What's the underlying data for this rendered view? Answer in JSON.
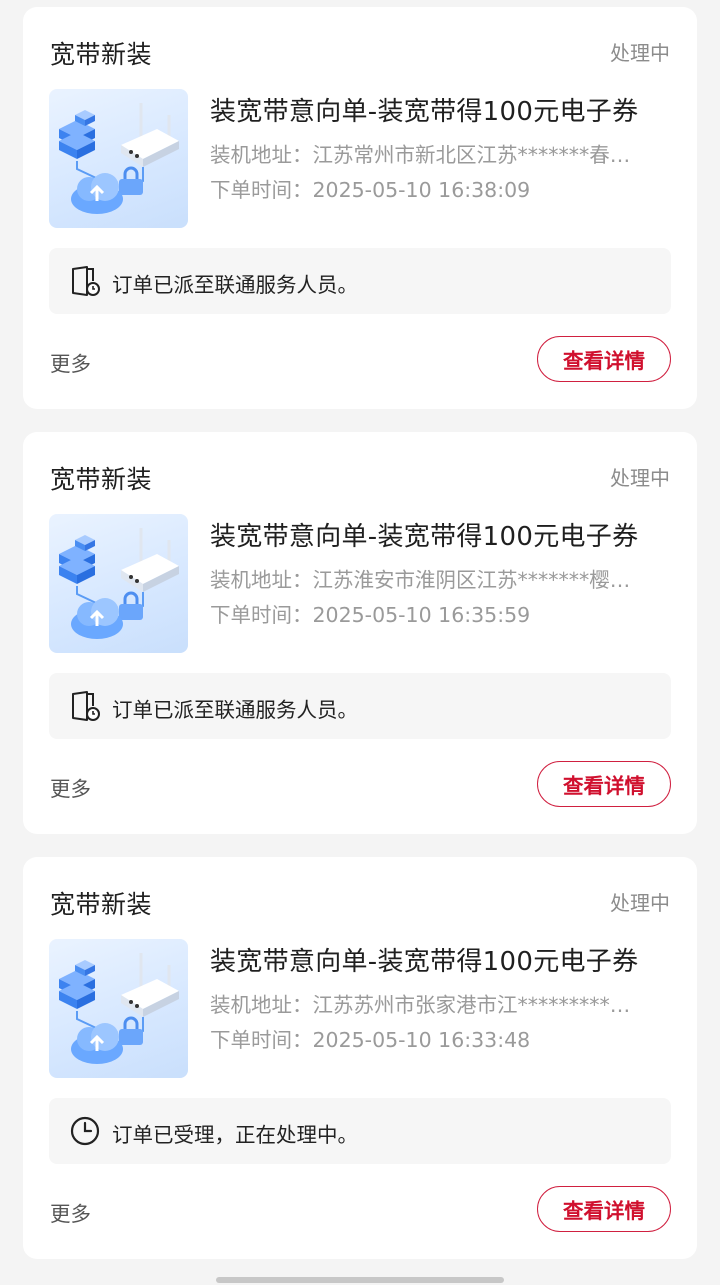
{
  "orders": [
    {
      "category": "宽带新装",
      "status": "处理中",
      "product_name": "装宽带意向单-装宽带得100元电子券",
      "address_line": "装机地址：江苏常州市新北区江苏*******春…",
      "time_line": "下单时间：2025-05-10 16:38:09",
      "notice_icon": "dispatch-door-icon",
      "notice": "订单已派至联通服务人员。",
      "more_label": "更多",
      "detail_label": "查看详情"
    },
    {
      "category": "宽带新装",
      "status": "处理中",
      "product_name": "装宽带意向单-装宽带得100元电子券",
      "address_line": "装机地址：江苏淮安市淮阴区江苏*******樱…",
      "time_line": "下单时间：2025-05-10 16:35:59",
      "notice_icon": "dispatch-door-icon",
      "notice": "订单已派至联通服务人员。",
      "more_label": "更多",
      "detail_label": "查看详情"
    },
    {
      "category": "宽带新装",
      "status": "处理中",
      "product_name": "装宽带意向单-装宽带得100元电子券",
      "address_line": "装机地址：江苏苏州市张家港市江*********…",
      "time_line": "下单时间：2025-05-10 16:33:48",
      "notice_icon": "clock-icon",
      "notice": "订单已受理，正在处理中。",
      "more_label": "更多",
      "detail_label": "查看详情"
    }
  ],
  "colors": {
    "accent": "#d0102e",
    "page_bg": "#f4f4f4",
    "card_bg": "#ffffff",
    "notice_bg": "#f6f6f6",
    "muted_text": "#9a9a9a"
  }
}
